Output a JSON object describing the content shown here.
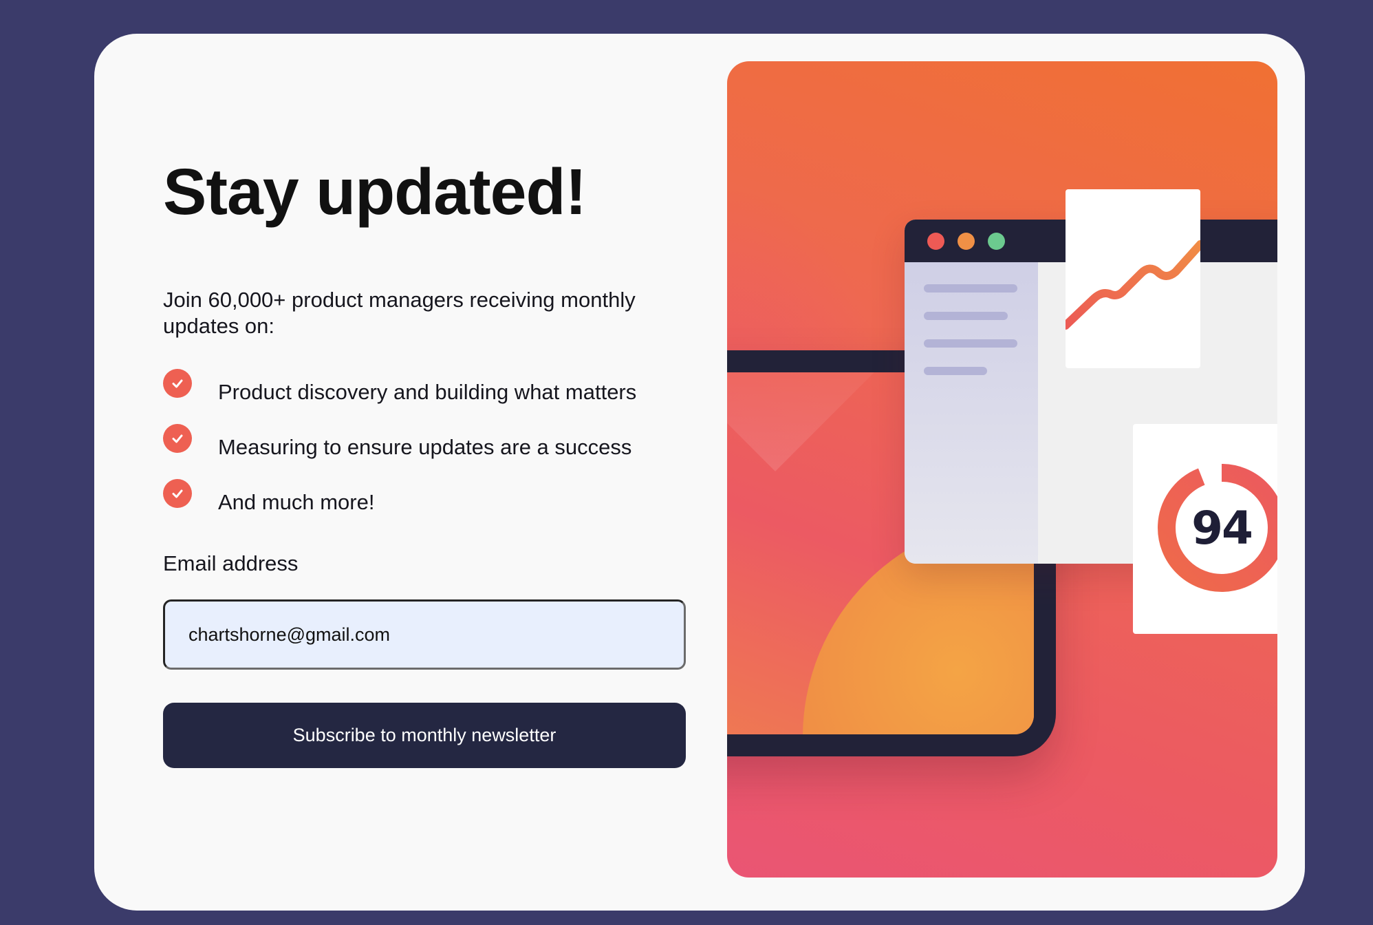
{
  "signup": {
    "title": "Stay updated!",
    "intro": "Join 60,000+ product managers receiving monthly updates on:",
    "features": [
      "Product discovery and building what matters",
      "Measuring to ensure updates are a success",
      "And much more!"
    ],
    "email_label": "Email address",
    "email_value": "chartshorne@gmail.com",
    "subscribe_label": "Subscribe to monthly newsletter"
  },
  "illustration": {
    "score": "94",
    "score_fraction": 0.94,
    "window_dots": [
      "red-dot",
      "orange-dot",
      "green-dot"
    ]
  },
  "colors": {
    "page_background": "#3b3b6a",
    "card_background": "#f9f9f9",
    "accent": "#ee6052",
    "button": "#242742",
    "input_fill": "#e8effd"
  }
}
